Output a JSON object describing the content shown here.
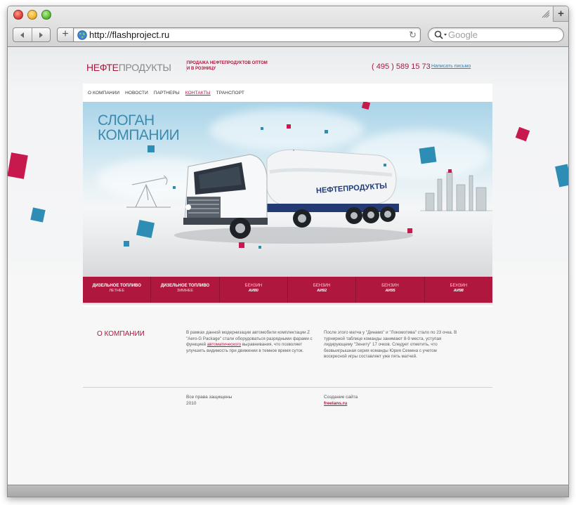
{
  "browser": {
    "url": "http://flashproject.ru",
    "search_placeholder": "Google"
  },
  "site": {
    "logo_part1": "НЕФТЕ",
    "logo_part2": "ПРОДУКТЫ",
    "tagline": "ПРОДАЖА НЕФТЕПРОДУКТОВ ОПТОМ И В РОЗНИЦУ",
    "phone": "( 495 ) 589 15 73",
    "mail_link": "Написать письмо",
    "nav": [
      {
        "label": "О КОМПАНИИ"
      },
      {
        "label": "НОВОСТИ"
      },
      {
        "label": "ПАРТНЕРЫ"
      },
      {
        "label": "КОНТАКТЫ",
        "active": true
      },
      {
        "label": "ТРАНСПОРТ"
      }
    ],
    "slogan_line1": "СЛОГАН",
    "slogan_line2": "КОМПАНИИ",
    "truck_label": "НЕФТЕПРОДУКТЫ",
    "products": [
      {
        "name": "ДИЗЕЛЬНОЕ ТОПЛИВО",
        "sub": "ЛЕТНЕЕ"
      },
      {
        "name": "ДИЗЕЛЬНОЕ ТОПЛИВО",
        "sub": "ЗИМНЕЕ"
      },
      {
        "name": "БЕНЗИН",
        "sub": "АИ80"
      },
      {
        "name": "БЕНЗИН",
        "sub": "АИ92"
      },
      {
        "name": "БЕНЗИН",
        "sub": "АИ95"
      },
      {
        "name": "БЕНЗИН",
        "sub": "АИ98"
      }
    ],
    "about_title": "О КОМПАНИИ",
    "about_col1_before": "В рамках данной модернизации автомобили комплектации Z \"Aero-G Package\" стали оборудоваться разрядными фарами с функцией ",
    "about_col1_link": "автоматического",
    "about_col1_after": " выравнивания, что позволяет улучшить видимость при движении в темное время суток.",
    "about_col2": "После этого матча у \"Динамо\" и \"Локомотива\" стало по 23 очка. В турнирной таблице команды занимают 8-9 места, уступая лидирующему \"Зениту\" 17 очков. Следует отметить, что безвыигрышная серия команды Юрия Семина с учетом воскресной игры составляет уже пять матчей.",
    "copyright_line1": "Все права защищены",
    "copyright_line2": "2010",
    "credit_label": "Создание сайта",
    "credit_link": "freelans.ru"
  },
  "colors": {
    "brand": "#b0153e",
    "slogan": "#3b8bb0",
    "accent_squares": [
      "#c8194f",
      "#2d8db5"
    ]
  }
}
